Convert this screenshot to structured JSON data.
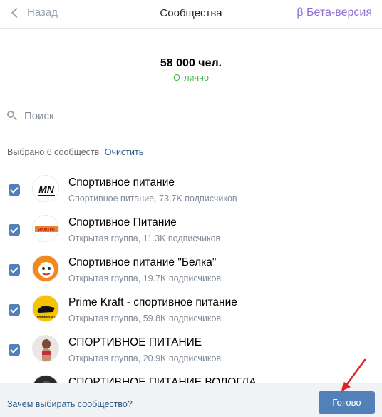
{
  "header": {
    "back_label": "Назад",
    "title": "Сообщества",
    "beta_label": "β Бета-версия",
    "beta_color": "#8d6fd6"
  },
  "audience": {
    "count": "58 000 чел.",
    "quality": "Отлично",
    "quality_color": "#4bb34b"
  },
  "search": {
    "placeholder": "Поиск",
    "icon": "search-icon"
  },
  "selection": {
    "summary": "Выбрано 6 сообществ",
    "clear_label": "Очистить"
  },
  "communities": [
    {
      "name": "Спортивное питание",
      "description": "Спортивное питание, 73.7K подписчиков",
      "checked": true,
      "avatar_text": "MN"
    },
    {
      "name": "Спортивное Питание",
      "description": "Открытая группа, 11.3K подписчиков",
      "checked": true,
      "avatar_text": "SPORTPIT"
    },
    {
      "name": "Спортивное питание \"Белка\"",
      "description": "Открытая группа, 19.7K подписчиков",
      "checked": true,
      "avatar_text": ""
    },
    {
      "name": "Prime Kraft - спортивное питание",
      "description": "Открытая группа, 59.8K подписчиков",
      "checked": true,
      "avatar_text": "PRIMEKRAFT"
    },
    {
      "name": "СПОРТИВНОЕ ПИТАНИЕ",
      "description": "Открытая группа, 20.9K подписчиков",
      "checked": true,
      "avatar_text": ""
    },
    {
      "name": "СПОРТИВНОЕ ПИТАНИЕ ВОЛОГДА",
      "description": "",
      "checked": true,
      "avatar_text": ""
    }
  ],
  "footer": {
    "why_label": "Зачем выбирать сообщество?",
    "done_label": "Готово",
    "accent_color": "#5181b8"
  },
  "annotation": {
    "arrow_color": "#e02020"
  }
}
